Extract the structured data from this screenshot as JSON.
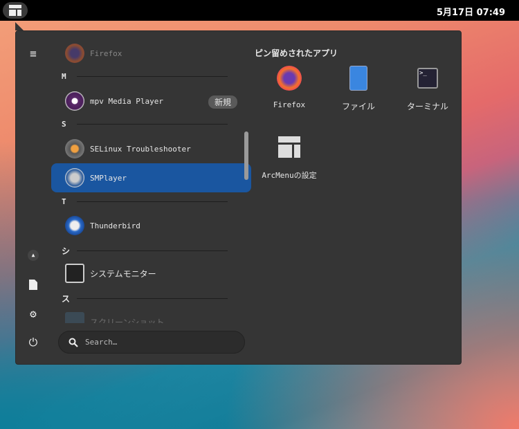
{
  "topbar": {
    "clock": "5月17日 07:49"
  },
  "sidebar": {
    "items": [
      "menu-icon",
      "user-icon",
      "documents-icon",
      "settings-icon",
      "power-icon"
    ]
  },
  "app_list": {
    "items": [
      {
        "type": "app",
        "label": "Firefox",
        "faded": true
      },
      {
        "type": "header",
        "label": "M"
      },
      {
        "type": "app",
        "label": "mpv Media Player",
        "badge": "新規"
      },
      {
        "type": "header",
        "label": "S"
      },
      {
        "type": "app",
        "label": "SELinux Troubleshooter"
      },
      {
        "type": "app",
        "label": "SMPlayer",
        "selected": true
      },
      {
        "type": "header",
        "label": "T"
      },
      {
        "type": "app",
        "label": "Thunderbird"
      },
      {
        "type": "header",
        "label": "シ"
      },
      {
        "type": "app",
        "label": "システムモニター"
      },
      {
        "type": "header",
        "label": "ス"
      },
      {
        "type": "app",
        "label": "スクリーンショット",
        "faded": true
      }
    ]
  },
  "search": {
    "placeholder": "Search…"
  },
  "pinned": {
    "title": "ピン留めされたアプリ",
    "apps": [
      "Firefox",
      "ファイル",
      "ターミナル",
      "ArcMenuの設定"
    ]
  },
  "colors": {
    "selection": "#1a56a0",
    "panel": "#353535"
  }
}
